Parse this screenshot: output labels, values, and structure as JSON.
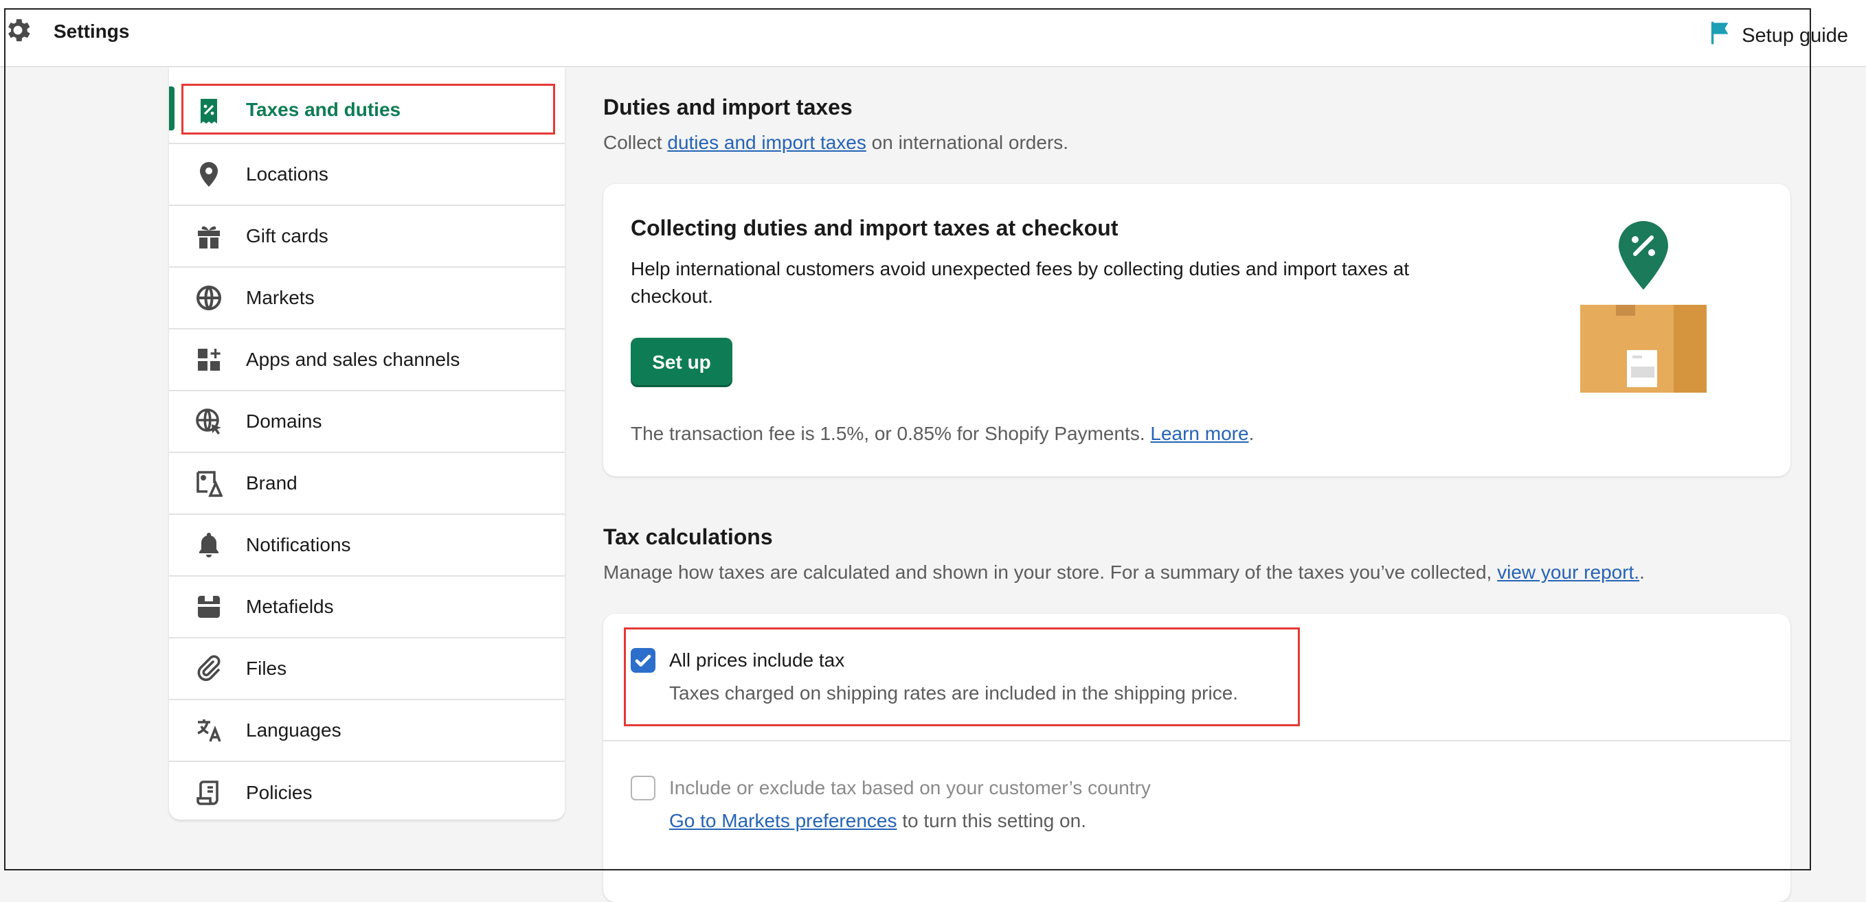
{
  "topbar": {
    "title": "Settings",
    "setup_guide": "Setup guide",
    "icons": {
      "settings": "gear-icon",
      "guide": "flag-icon"
    },
    "guide_icon_color": "#1a9fb5"
  },
  "sidebar": {
    "items": [
      {
        "label": "Taxes and duties",
        "icon": "receipt-percent-icon",
        "active": true
      },
      {
        "label": "Locations",
        "icon": "location-pin-icon"
      },
      {
        "label": "Gift cards",
        "icon": "gift-icon"
      },
      {
        "label": "Markets",
        "icon": "globe-target-icon"
      },
      {
        "label": "Apps and sales channels",
        "icon": "apps-icon"
      },
      {
        "label": "Domains",
        "icon": "globe-cursor-icon"
      },
      {
        "label": "Brand",
        "icon": "brand-image-icon"
      },
      {
        "label": "Notifications",
        "icon": "bell-icon"
      },
      {
        "label": "Metafields",
        "icon": "metafields-icon"
      },
      {
        "label": "Files",
        "icon": "paperclip-icon"
      },
      {
        "label": "Languages",
        "icon": "translate-icon"
      },
      {
        "label": "Policies",
        "icon": "scroll-icon"
      }
    ]
  },
  "duties": {
    "title": "Duties and import taxes",
    "subtitle_prefix": "Collect ",
    "subtitle_link": "duties and import taxes",
    "subtitle_suffix": " on international orders.",
    "card": {
      "title": "Collecting duties and import taxes at checkout",
      "description": "Help international customers avoid unexpected fees by collecting duties and import taxes at checkout.",
      "button": "Set up",
      "fee_text": "The transaction fee is 1.5%, or 0.85% for Shopify Payments. ",
      "fee_link": "Learn more",
      "fee_end": "."
    }
  },
  "tax_calc": {
    "title": "Tax calculations",
    "subtitle_prefix": "Manage how taxes are calculated and shown in your store. For a summary of the taxes you’ve collected, ",
    "subtitle_link": "view your report.",
    "subtitle_suffix": ".",
    "options": [
      {
        "label": "All prices include tax",
        "detail": "Taxes charged on shipping rates are included in the shipping price.",
        "checked": true
      },
      {
        "label": "Include or exclude tax based on your customer’s country",
        "detail_link": "Go to Markets preferences",
        "detail_suffix": " to turn this setting on.",
        "checked": false,
        "disabled": true
      }
    ]
  },
  "colors": {
    "accent_green": "#0e7c55",
    "link_blue": "#2563b6",
    "checkbox_blue": "#2c6ecb",
    "highlight_red": "#e53935"
  }
}
